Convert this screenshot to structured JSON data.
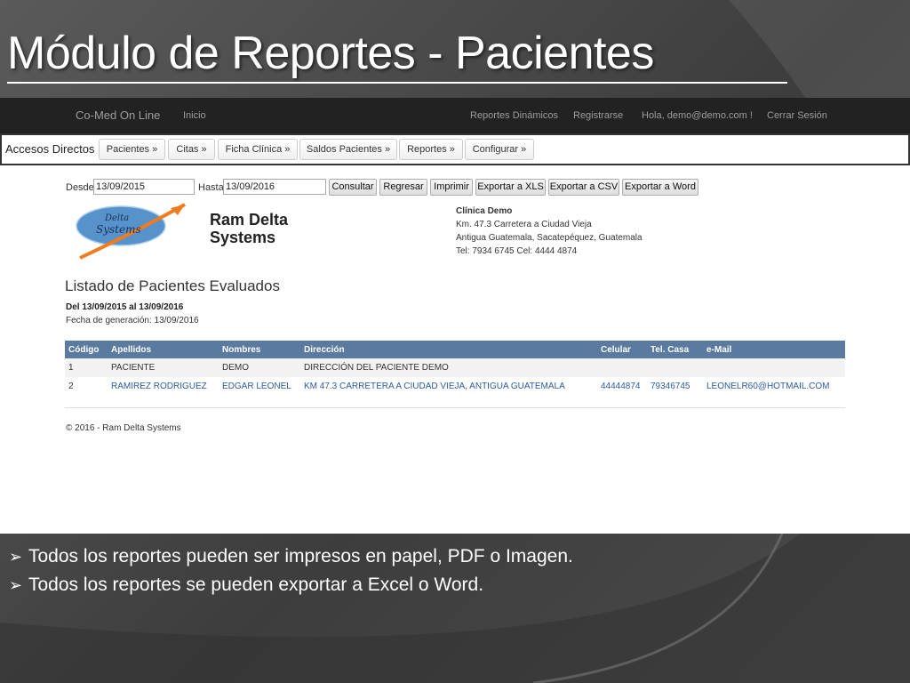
{
  "slide": {
    "title": "Módulo de Reportes - Pacientes",
    "bullets": [
      "Todos los reportes pueden ser impresos en papel, PDF o Imagen.",
      "Todos los reportes se pueden exportar a Excel o Word."
    ]
  },
  "navbar": {
    "brand": "Co-Med On Line",
    "inicio": "Inicio",
    "reportes_dinamicos": "Reportes Dinámicos",
    "registrarse": "Registrarse",
    "greeting": "Hola, demo@demo.com !",
    "cerrar_sesion": "Cerrar Sesión"
  },
  "accesos": {
    "label": "Accesos Directos",
    "buttons": [
      "Pacientes »",
      "Citas »",
      "Ficha Clínica »",
      "Saldos Pacientes »",
      "Reportes »",
      "Configurar »"
    ]
  },
  "filters": {
    "desde_label": "Desde",
    "desde_value": "13/09/2015",
    "hasta_label": "Hasta",
    "hasta_value": "13/09/2016",
    "buttons": [
      "Consultar",
      "Regresar",
      "Imprimir",
      "Exportar a XLS",
      "Exportar a CSV",
      "Exportar a Word"
    ]
  },
  "company": {
    "name_line1": "Ram Delta",
    "name_line2": "Systems",
    "logo_text": "Delta Systems"
  },
  "clinic": {
    "name": "Clínica Demo",
    "address1": "Km. 47.3 Carretera a Ciudad Vieja",
    "address2": "Antigua Guatemala, Sacatepéquez, Guatemala",
    "phones": "Tel: 7934 6745 Cel: 4444 4874"
  },
  "report": {
    "title": "Listado de Pacientes Evaluados",
    "range": "Del 13/09/2015 al 13/09/2016",
    "generated": "Fecha de generación: 13/09/2016",
    "columns": [
      "Código",
      "Apellidos",
      "Nombres",
      "Dirección",
      "Celular",
      "Tel. Casa",
      "e-Mail"
    ],
    "rows": [
      [
        "1",
        "PACIENTE",
        "DEMO",
        "DIRECCIÓN DEL PACIENTE DEMO",
        "",
        "",
        ""
      ],
      [
        "2",
        "RAMIREZ RODRIGUEZ",
        "EDGAR LEONEL",
        "KM 47.3 CARRETERA A CIUDAD VIEJA, ANTIGUA GUATEMALA",
        "44444874",
        "79346745",
        "LEONELR60@HOTMAIL.COM"
      ]
    ],
    "footer": "© 2016 - Ram Delta Systems"
  },
  "colors": {
    "navbar_bg": "#222222",
    "table_header_bg": "#5b7aa0",
    "logo_orange": "#f07c1e",
    "logo_blue": "#3a7fc1"
  }
}
